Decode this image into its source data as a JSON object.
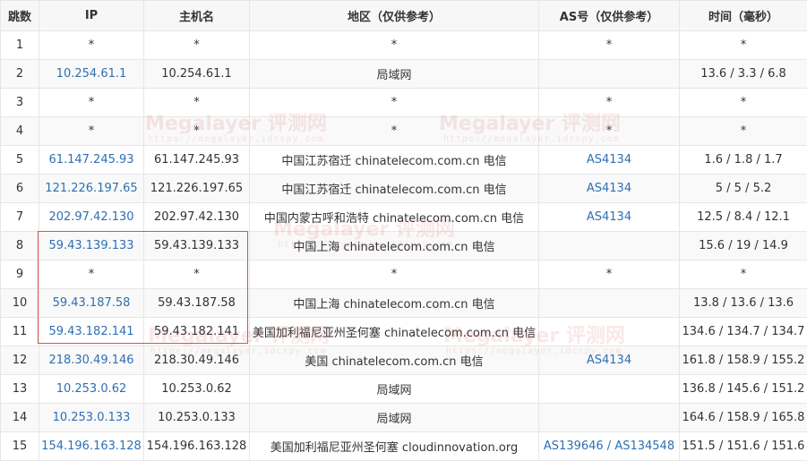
{
  "headers": [
    "跳数",
    "IP",
    "主机名",
    "地区（仅供参考）",
    "AS号（仅供参考）",
    "时间（毫秒）"
  ],
  "rows": [
    {
      "hop": "1",
      "ip": "*",
      "host": "*",
      "region": "*",
      "as": "*",
      "time": "*"
    },
    {
      "hop": "2",
      "ip": "10.254.61.1",
      "host": "10.254.61.1",
      "region": "局域网",
      "as": "",
      "time": "13.6 / 3.3 / 6.8"
    },
    {
      "hop": "3",
      "ip": "*",
      "host": "*",
      "region": "*",
      "as": "*",
      "time": "*"
    },
    {
      "hop": "4",
      "ip": "*",
      "host": "*",
      "region": "*",
      "as": "*",
      "time": "*"
    },
    {
      "hop": "5",
      "ip": "61.147.245.93",
      "host": "61.147.245.93",
      "region": "中国江苏宿迁 chinatelecom.com.cn 电信",
      "as": "AS4134",
      "time": "1.6 / 1.8 / 1.7"
    },
    {
      "hop": "6",
      "ip": "121.226.197.65",
      "host": "121.226.197.65",
      "region": "中国江苏宿迁 chinatelecom.com.cn 电信",
      "as": "AS4134",
      "time": "5 / 5 / 5.2"
    },
    {
      "hop": "7",
      "ip": "202.97.42.130",
      "host": "202.97.42.130",
      "region": "中国内蒙古呼和浩特 chinatelecom.com.cn 电信",
      "as": "AS4134",
      "time": "12.5 / 8.4 / 12.1"
    },
    {
      "hop": "8",
      "ip": "59.43.139.133",
      "host": "59.43.139.133",
      "region": "中国上海 chinatelecom.com.cn 电信",
      "as": "",
      "time": "15.6 / 19 / 14.9"
    },
    {
      "hop": "9",
      "ip": "*",
      "host": "*",
      "region": "*",
      "as": "*",
      "time": "*"
    },
    {
      "hop": "10",
      "ip": "59.43.187.58",
      "host": "59.43.187.58",
      "region": "中国上海 chinatelecom.com.cn 电信",
      "as": "",
      "time": "13.8 / 13.6 / 13.6"
    },
    {
      "hop": "11",
      "ip": "59.43.182.141",
      "host": "59.43.182.141",
      "region": "美国加利福尼亚州圣何塞 chinatelecom.com.cn 电信",
      "as": "",
      "time": "134.6 / 134.7 / 134.7"
    },
    {
      "hop": "12",
      "ip": "218.30.49.146",
      "host": "218.30.49.146",
      "region": "美国 chinatelecom.com.cn 电信",
      "as": "AS4134",
      "time": "161.8 / 158.9 / 155.2"
    },
    {
      "hop": "13",
      "ip": "10.253.0.62",
      "host": "10.253.0.62",
      "region": "局域网",
      "as": "",
      "time": "136.8 / 145.6 / 151.2"
    },
    {
      "hop": "14",
      "ip": "10.253.0.133",
      "host": "10.253.0.133",
      "region": "局域网",
      "as": "",
      "time": "164.6 / 158.9 / 165.8"
    },
    {
      "hop": "15",
      "ip": "154.196.163.128",
      "host": "154.196.163.128",
      "region": "美国加利福尼亚州圣何塞 cloudinnovation.org",
      "as": "AS139646 / AS134548",
      "time": "151.5 / 151.6 / 151.6"
    }
  ],
  "watermark": {
    "text": "Megalayer 评测网",
    "url": "https://megalayer.idcspy.com"
  },
  "colors": {
    "link": "#2f6fb3",
    "highlight": "#d9534f",
    "header_bg": "#f7f7f7",
    "border": "#e6e6e6"
  }
}
